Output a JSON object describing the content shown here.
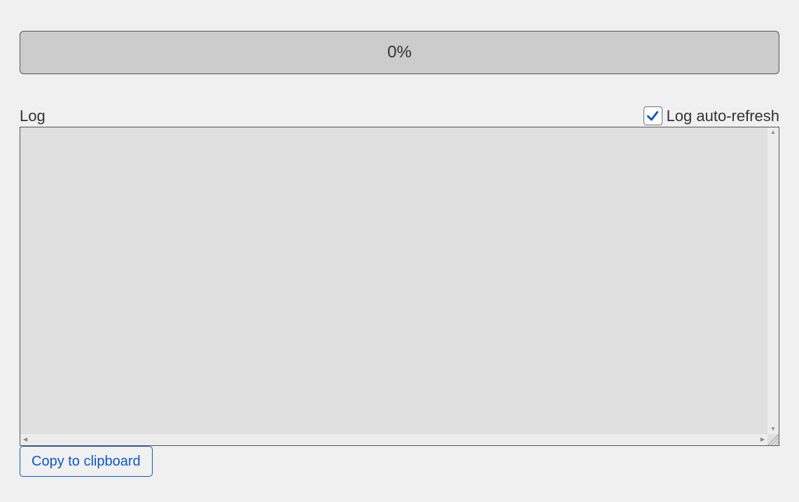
{
  "progress": {
    "percent_text": "0%",
    "percent_value": 0
  },
  "log": {
    "label": "Log",
    "auto_refresh_label": "Log auto-refresh",
    "auto_refresh_checked": true,
    "content": ""
  },
  "actions": {
    "copy_label": "Copy to clipboard"
  },
  "colors": {
    "accent": "#0a58ca",
    "progress_bg": "#cccccc",
    "page_bg": "#f0f0f0",
    "log_bg": "#e0e0e0"
  }
}
